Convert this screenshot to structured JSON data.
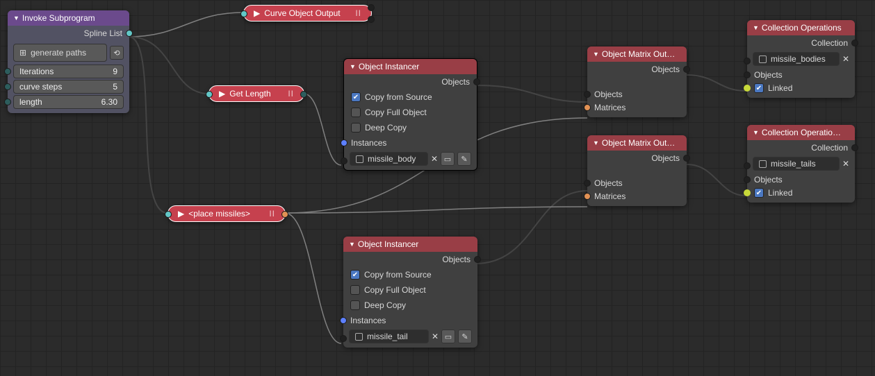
{
  "invoke": {
    "title": "Invoke Subprogram",
    "output": "Spline List",
    "button": "generate paths",
    "iterations_label": "Iterations",
    "iterations_val": "9",
    "curvesteps_label": "curve steps",
    "curvesteps_val": "5",
    "length_label": "length",
    "length_val": "6.30"
  },
  "curve_output": {
    "title": "Curve Object Output"
  },
  "get_length": {
    "title": "Get Length"
  },
  "place_missiles": {
    "title": "<place missiles>"
  },
  "instancer1": {
    "title": "Object Instancer",
    "objects": "Objects",
    "copy_source": "Copy from Source",
    "copy_full": "Copy Full Object",
    "deep_copy": "Deep Copy",
    "instances": "Instances",
    "obj_name": "missile_body"
  },
  "instancer2": {
    "title": "Object Instancer",
    "objects": "Objects",
    "copy_source": "Copy from Source",
    "copy_full": "Copy Full Object",
    "deep_copy": "Deep Copy",
    "instances": "Instances",
    "obj_name": "missile_tail"
  },
  "matrix1": {
    "title": "Object Matrix Out…",
    "objects_out": "Objects",
    "objects_in": "Objects",
    "matrices": "Matrices"
  },
  "matrix2": {
    "title": "Object Matrix Out…",
    "objects_out": "Objects",
    "objects_in": "Objects",
    "matrices": "Matrices"
  },
  "collop1": {
    "title": "Collection Operations",
    "collection": "Collection",
    "coll_name": "missile_bodies",
    "objects": "Objects",
    "linked": "Linked"
  },
  "collop2": {
    "title": "Collection Operatio…",
    "collection": "Collection",
    "coll_name": "missile_tails",
    "objects": "Objects",
    "linked": "Linked"
  }
}
